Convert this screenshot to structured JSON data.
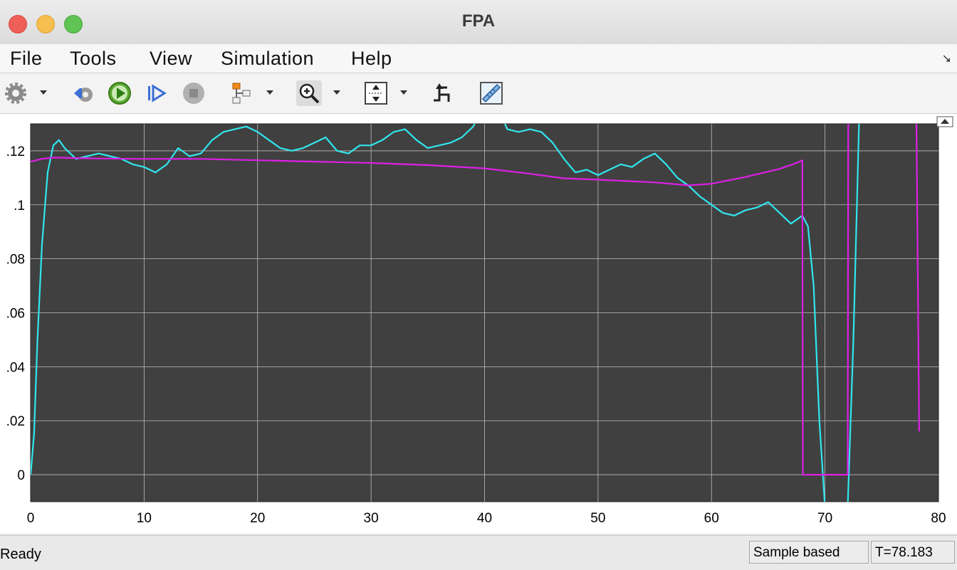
{
  "window": {
    "title": "FPA"
  },
  "menu": {
    "file": "File",
    "tools": "Tools",
    "view": "View",
    "simulation": "Simulation",
    "help": "Help"
  },
  "toolbar": {
    "icons": [
      "gear-icon",
      "step-back-icon",
      "run-icon",
      "step-forward-icon",
      "stop-icon",
      "signal-hierarchy-icon",
      "zoom-in-icon",
      "autoscale-icon",
      "triggers-icon",
      "measure-icon"
    ]
  },
  "colors": {
    "plot_bg": "#404040",
    "grid": "#bdbdbd",
    "cyan": "#30e6ee",
    "magenta": "#dd1fe6"
  },
  "chart_data": {
    "type": "line",
    "xlim": [
      0,
      80
    ],
    "ylim": [
      -0.01,
      0.13
    ],
    "x_ticks": [
      "0",
      "10",
      "20",
      "30",
      "40",
      "50",
      "60",
      "70",
      "80"
    ],
    "y_ticks": [
      ".12",
      ".1",
      ".08",
      ".06",
      ".04",
      ".02",
      "0"
    ],
    "y_tick_values": [
      0.12,
      0.1,
      0.08,
      0.06,
      0.04,
      0.02,
      0
    ],
    "grid": true,
    "series": [
      {
        "color": "#30e6ee",
        "x": [
          0,
          0.3,
          0.6,
          1,
          1.5,
          2,
          2.5,
          3,
          4,
          5,
          6,
          7,
          8,
          9,
          10,
          11,
          12,
          13,
          14,
          15,
          16,
          17,
          18,
          19,
          20,
          21,
          22,
          23,
          24,
          25,
          26,
          27,
          28,
          29,
          30,
          31,
          32,
          33,
          34,
          35,
          36,
          37,
          38,
          39,
          39.5,
          41.5,
          42,
          43,
          44,
          45,
          46,
          47,
          48,
          49,
          50,
          51,
          52,
          53,
          54,
          55,
          56,
          57,
          58,
          59,
          60,
          61,
          62,
          63,
          64,
          65,
          66,
          67,
          68,
          68.5,
          69,
          69.5,
          70,
          71,
          72,
          72.5,
          73
        ],
        "y": [
          0,
          0.015,
          0.05,
          0.085,
          0.112,
          0.122,
          0.124,
          0.121,
          0.117,
          0.118,
          0.119,
          0.118,
          0.117,
          0.115,
          0.114,
          0.112,
          0.115,
          0.121,
          0.118,
          0.119,
          0.124,
          0.127,
          0.128,
          0.129,
          0.127,
          0.124,
          0.121,
          0.12,
          0.121,
          0.123,
          0.125,
          0.12,
          0.119,
          0.122,
          0.122,
          0.124,
          0.127,
          0.128,
          0.124,
          0.121,
          0.122,
          0.123,
          0.125,
          0.129,
          0.133,
          0.133,
          0.128,
          0.127,
          0.128,
          0.127,
          0.123,
          0.117,
          0.112,
          0.113,
          0.111,
          0.113,
          0.115,
          0.114,
          0.117,
          0.119,
          0.115,
          0.11,
          0.107,
          0.103,
          0.1,
          0.097,
          0.096,
          0.098,
          0.099,
          0.101,
          0.097,
          0.093,
          0.096,
          0.092,
          0.07,
          0.02,
          -0.012,
          -0.025,
          -0.012,
          0.05,
          0.13
        ]
      },
      {
        "color": "#dd1fe6",
        "x": [
          0,
          1,
          2,
          5,
          10,
          15,
          20,
          25,
          30,
          35,
          40,
          44,
          47,
          50,
          55,
          58,
          60,
          63,
          66,
          67.5,
          68,
          68.05,
          69,
          70,
          71,
          72,
          72.05,
          78,
          78.05,
          78.3
        ],
        "y": [
          0.116,
          0.117,
          0.1175,
          0.1172,
          0.117,
          0.117,
          0.1165,
          0.116,
          0.1155,
          0.1147,
          0.1135,
          0.1115,
          0.1098,
          0.1093,
          0.1083,
          0.1072,
          0.1078,
          0.1103,
          0.1133,
          0.1155,
          0.1165,
          0,
          0,
          0,
          0,
          0,
          0.135,
          0.135,
          0.135,
          0.016
        ]
      }
    ]
  },
  "status": {
    "ready": "Ready",
    "mode": "Sample based",
    "time": "T=78.183"
  }
}
